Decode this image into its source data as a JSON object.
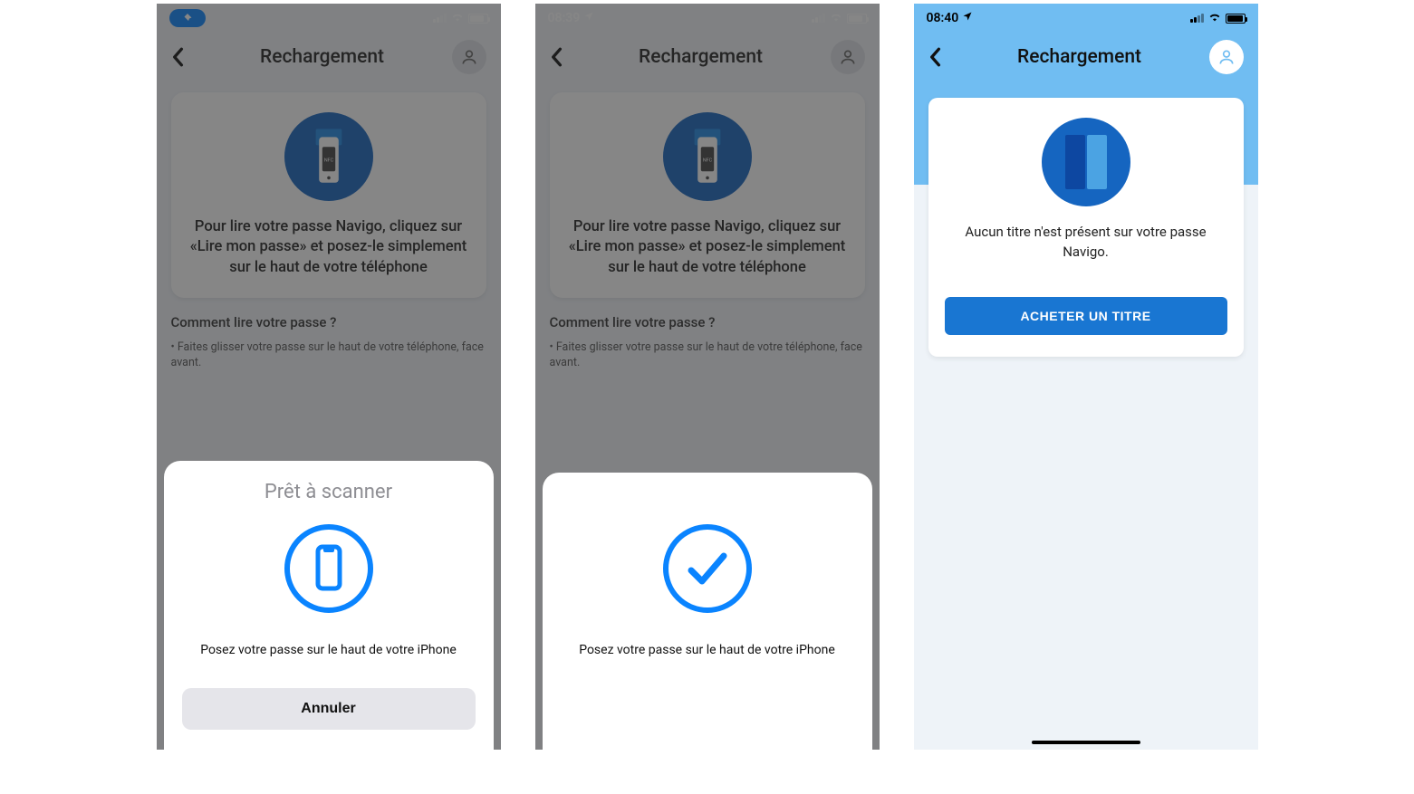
{
  "screens": [
    {
      "statusbar": {
        "left_pill": "location",
        "time": "",
        "icons": [
          "signal",
          "wifi",
          "battery"
        ]
      },
      "header": {
        "title": "Rechargement"
      },
      "info_card": {
        "text": "Pour lire votre passe Navigo, cliquez sur «Lire mon passe» et posez-le simplement sur le haut de votre téléphone"
      },
      "help": {
        "heading": "Comment lire votre passe ?",
        "bullet": "• Faites glisser votre passe sur le haut de votre téléphone, face avant."
      },
      "nfc_sheet": {
        "title": "Prêt à scanner",
        "instruction": "Posez votre passe sur le haut de votre iPhone",
        "cancel": "Annuler",
        "icon": "phone-outline"
      }
    },
    {
      "statusbar": {
        "time": "08:39",
        "location_arrow": true,
        "icons": [
          "signal",
          "wifi",
          "battery"
        ]
      },
      "header": {
        "title": "Rechargement"
      },
      "info_card": {
        "text": "Pour lire votre passe Navigo, cliquez sur «Lire mon passe» et posez-le simplement sur le haut de votre téléphone"
      },
      "help": {
        "heading": "Comment lire votre passe ?",
        "bullet": "• Faites glisser votre passe sur le haut de votre téléphone, face avant."
      },
      "nfc_sheet": {
        "title": "",
        "instruction": "Posez votre passe sur le haut de votre iPhone",
        "icon": "checkmark"
      }
    },
    {
      "statusbar": {
        "time": "08:40",
        "location_arrow": true,
        "icons": [
          "signal",
          "wifi",
          "battery"
        ],
        "dark_battery": true
      },
      "header": {
        "title": "Rechargement"
      },
      "result_card": {
        "text": "Aucun titre n'est présent sur votre passe Navigo.",
        "buy_button": "ACHETER UN TITRE"
      }
    }
  ]
}
